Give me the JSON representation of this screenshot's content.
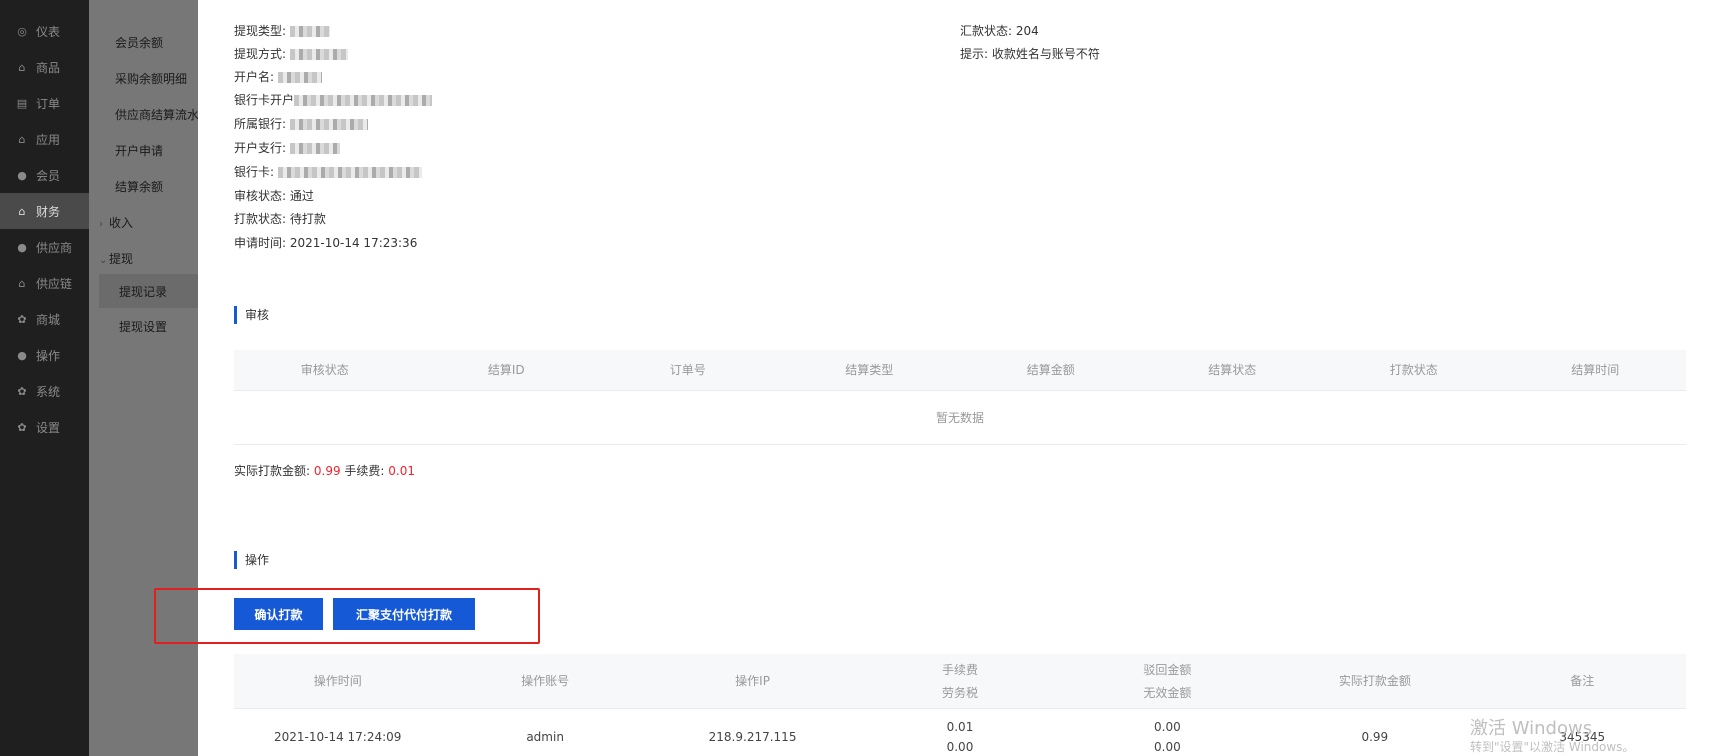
{
  "nav": {
    "items": [
      {
        "label": "仪表",
        "icon": "gauge-icon",
        "glyph": "◎"
      },
      {
        "label": "商品",
        "icon": "bag-icon",
        "glyph": "⌂"
      },
      {
        "label": "订单",
        "icon": "clipboard-icon",
        "glyph": "▤"
      },
      {
        "label": "应用",
        "icon": "bag-icon",
        "glyph": "⌂"
      },
      {
        "label": "会员",
        "icon": "user-icon",
        "glyph": "●"
      },
      {
        "label": "财务",
        "icon": "bag-icon",
        "glyph": "⌂"
      },
      {
        "label": "供应商",
        "icon": "user-icon",
        "glyph": "●"
      },
      {
        "label": "供应链",
        "icon": "bag-icon",
        "glyph": "⌂"
      },
      {
        "label": "商城",
        "icon": "gear-icon",
        "glyph": "✿"
      },
      {
        "label": "操作",
        "icon": "user-icon",
        "glyph": "●"
      },
      {
        "label": "系统",
        "icon": "gear-icon",
        "glyph": "✿"
      },
      {
        "label": "设置",
        "icon": "gear-icon",
        "glyph": "✿"
      }
    ],
    "active": "财务"
  },
  "submenu": {
    "items": [
      "会员余额",
      "采购余额明细",
      "供应商结算流水",
      "开户申请",
      "结算余额"
    ],
    "group_income": "收入",
    "group_withdraw": "提现",
    "withdraw_children": [
      "提现记录",
      "提现设置"
    ],
    "selected": "提现记录",
    "collapsed_chevron": "›",
    "expanded_chevron": "⌄"
  },
  "details": {
    "withdraw_type_label": "提现类型:",
    "withdraw_method_label": "提现方式:",
    "account_name_label": "开户名:",
    "bank_open_label": "银行卡开户",
    "bank_label": "所属银行:",
    "branch_label": "开户支行:",
    "card_label": "银行卡:",
    "audit_status_label": "审核状态:",
    "audit_status_value": "通过",
    "pay_status_label": "打款状态:",
    "pay_status_value": "待打款",
    "apply_time_label": "申请时间:",
    "apply_time_value": "2021-10-14 17:23:36",
    "remit_status_label": "汇款状态:",
    "remit_status_value": "204",
    "tip_label": "提示:",
    "tip_value": "收款姓名与账号不符"
  },
  "audit_section": {
    "title": "审核",
    "columns": [
      "审核状态",
      "结算ID",
      "订单号",
      "结算类型",
      "结算金额",
      "结算状态",
      "打款状态",
      "结算时间"
    ],
    "empty_text": "暂无数据"
  },
  "amounts": {
    "actual_label": "实际打款金额:",
    "actual_value": "0.99",
    "fee_label": "手续费:",
    "fee_value": "0.01"
  },
  "operation_section": {
    "title": "操作",
    "confirm_button": "确认打款",
    "huiju_button": "汇聚支付代付打款",
    "columns": {
      "time": "操作时间",
      "account": "操作账号",
      "ip": "操作IP",
      "fee_line1": "手续费",
      "fee_line2": "劳务税",
      "reject_line1": "驳回金额",
      "reject_line2": "无效金额",
      "actual": "实际打款金额",
      "remark": "备注"
    },
    "rows": [
      {
        "time": "2021-10-14 17:24:09",
        "account": "admin",
        "ip": "218.9.217.115",
        "fee": "0.01",
        "labor_tax": "0.00",
        "reject": "0.00",
        "invalid": "0.00",
        "actual": "0.99",
        "remark": "345345"
      }
    ]
  },
  "watermark": {
    "line1": "激活 Windows",
    "line2": "转到\"设置\"以激活 Windows。"
  },
  "colors": {
    "primary": "#1559d6",
    "danger": "#f5222d",
    "highlight": "#e02020",
    "nav_bg": "#1f1f1f"
  }
}
